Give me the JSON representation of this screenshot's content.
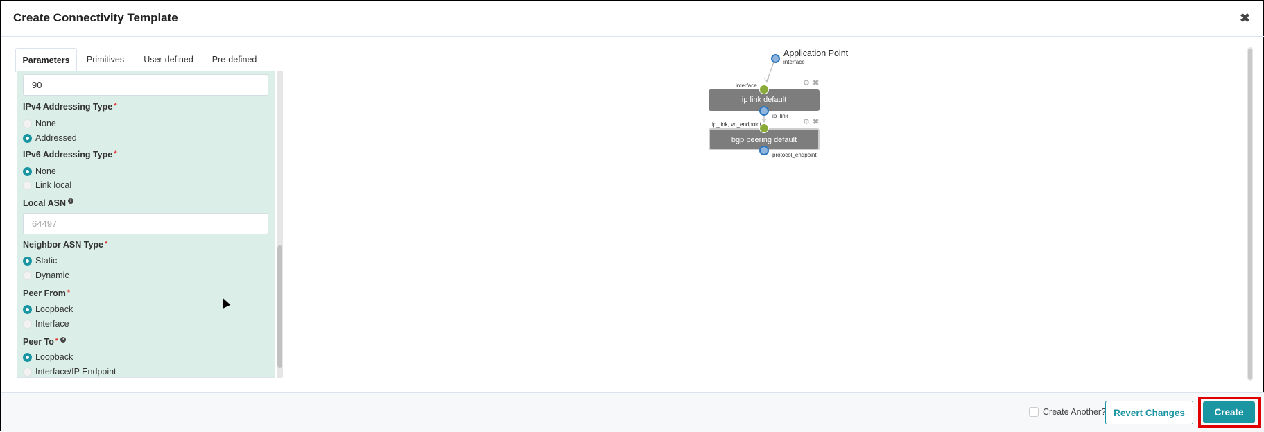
{
  "dialog": {
    "title": "Create Connectivity Template",
    "close_icon": "close-icon"
  },
  "tabs": [
    {
      "label": "Parameters",
      "active": true
    },
    {
      "label": "Primitives"
    },
    {
      "label": "User-defined"
    },
    {
      "label": "Pre-defined"
    }
  ],
  "form": {
    "top_input_value": "90",
    "ipv4": {
      "label": "IPv4 Addressing Type",
      "required": "*",
      "options": [
        "None",
        "Addressed"
      ],
      "selected": "Addressed"
    },
    "ipv6": {
      "label": "IPv6 Addressing Type",
      "required": "*",
      "options": [
        "None",
        "Link local"
      ],
      "selected": "None"
    },
    "local_asn": {
      "label": "Local ASN",
      "info_icon": "info-icon",
      "placeholder": "64497"
    },
    "neighbor_asn": {
      "label": "Neighbor ASN Type",
      "required": "*",
      "options": [
        "Static",
        "Dynamic"
      ],
      "selected": "Static"
    },
    "peer_from": {
      "label": "Peer From",
      "required": "*",
      "options": [
        "Loopback",
        "Interface"
      ],
      "selected": "Loopback"
    },
    "peer_to": {
      "label": "Peer To",
      "required": "*",
      "info_icon": "info-icon",
      "options": [
        "Loopback",
        "Interface/IP Endpoint"
      ],
      "selected": "Loopback"
    }
  },
  "diagram": {
    "app_point": {
      "title": "Application Point",
      "port": "interface"
    },
    "nodes": [
      {
        "label": "ip link default",
        "in_port": "interface",
        "out_port": "ip_link"
      },
      {
        "label": "bgp peering default",
        "in_port": "ip_link, vn_endpoint",
        "out_port": "protocol_endpoint"
      }
    ],
    "colors": {
      "input_port": "#8aaa3a",
      "output_port": "#8fb5dc",
      "node": "#7d7d7d"
    }
  },
  "footer": {
    "create_another": "Create Another?",
    "create_another_checked": false,
    "revert": "Revert Changes",
    "create": "Create"
  },
  "colors": {
    "accent": "#1a95a2",
    "panel": "#dbeee7",
    "highlight": "#e00000"
  }
}
